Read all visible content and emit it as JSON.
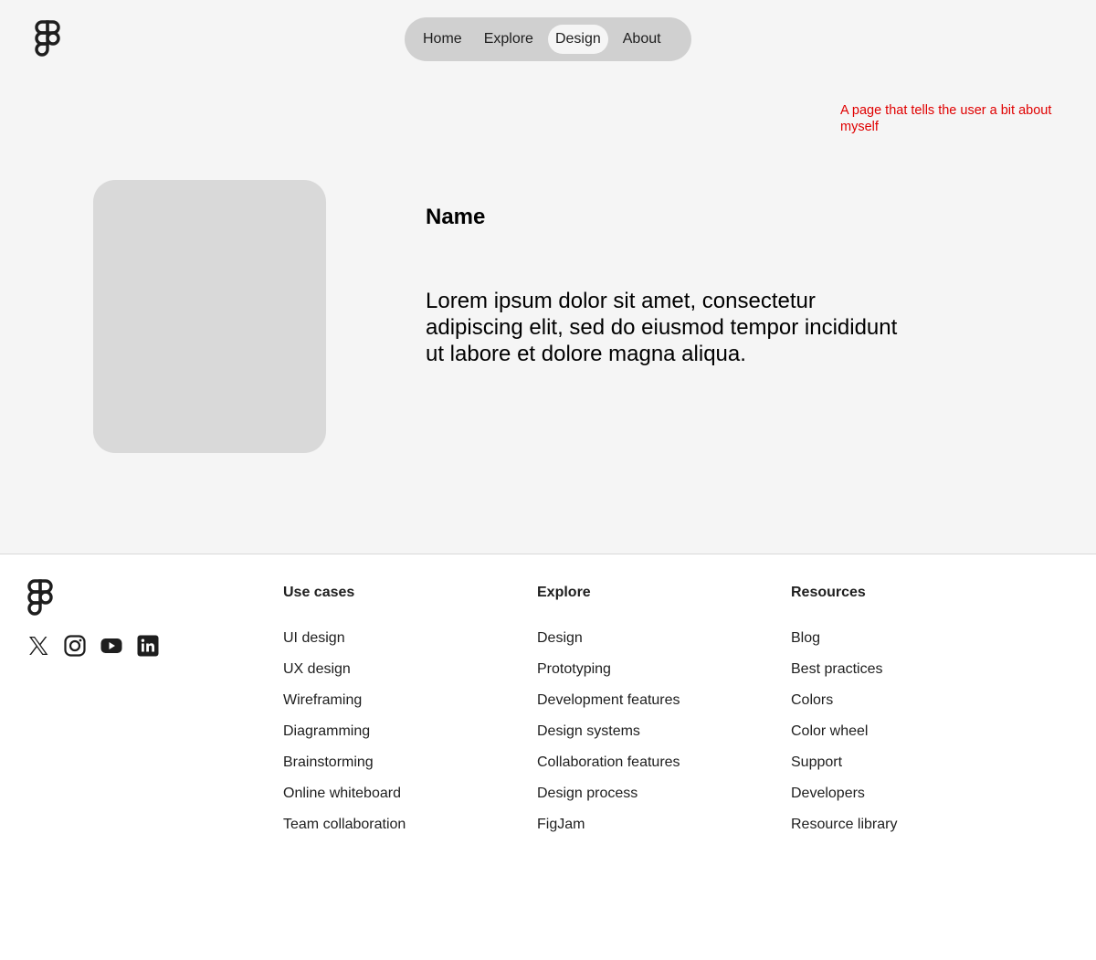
{
  "header": {
    "logo_icon": "figma-logo-icon",
    "nav": [
      {
        "label": "Home",
        "active": false
      },
      {
        "label": "Explore",
        "active": false
      },
      {
        "label": "Design",
        "active": true
      },
      {
        "label": "About",
        "active": false
      }
    ]
  },
  "annotation": {
    "text": "A page that tells the user a bit about myself",
    "color": "#e00000"
  },
  "profile": {
    "name": "Name",
    "bio": "Lorem ipsum dolor sit amet, consectetur adipiscing elit, sed do eiusmod tempor incididunt ut labore et dolore magna aliqua."
  },
  "footer": {
    "logo_icon": "figma-logo-icon",
    "socials": [
      "x-icon",
      "instagram-icon",
      "youtube-icon",
      "linkedin-icon"
    ],
    "columns": [
      {
        "title": "Use cases",
        "links": [
          "UI design",
          "UX design",
          "Wireframing",
          "Diagramming",
          "Brainstorming",
          "Online whiteboard",
          "Team collaboration"
        ]
      },
      {
        "title": "Explore",
        "links": [
          "Design",
          "Prototyping",
          "Development features",
          "Design systems",
          "Collaboration features",
          "Design process",
          "FigJam"
        ]
      },
      {
        "title": "Resources",
        "links": [
          "Blog",
          "Best practices",
          "Colors",
          "Color wheel",
          "Support",
          "Developers",
          "Resource library"
        ]
      }
    ]
  },
  "colors": {
    "hero_bg": "#f5f5f5",
    "nav_bg": "#d0d0d0",
    "placeholder": "#d9d9d9",
    "text": "#1e1e1e"
  }
}
